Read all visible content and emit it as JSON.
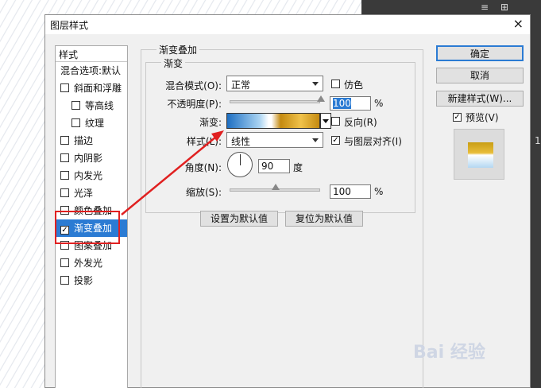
{
  "dialog": {
    "title": "图层样式",
    "close_icon": "×"
  },
  "left_panel": {
    "header": "样式",
    "items": [
      {
        "label": "混合选项:默认",
        "checkbox": false
      },
      {
        "label": "斜面和浮雕",
        "checkbox": true,
        "checked": false
      },
      {
        "label": "等高线",
        "checkbox": true,
        "checked": false
      },
      {
        "label": "纹理",
        "checkbox": true,
        "checked": false
      },
      {
        "label": "描边",
        "checkbox": true,
        "checked": false
      },
      {
        "label": "内阴影",
        "checkbox": true,
        "checked": false
      },
      {
        "label": "内发光",
        "checkbox": true,
        "checked": false
      },
      {
        "label": "光泽",
        "checkbox": true,
        "checked": false
      },
      {
        "label": "颜色叠加",
        "checkbox": true,
        "checked": false
      },
      {
        "label": "渐变叠加",
        "checkbox": true,
        "checked": true,
        "selected": true
      },
      {
        "label": "图案叠加",
        "checkbox": true,
        "checked": false
      },
      {
        "label": "外发光",
        "checkbox": true,
        "checked": false
      },
      {
        "label": "投影",
        "checkbox": true,
        "checked": false
      }
    ]
  },
  "gradient_overlay": {
    "group_title": "渐变叠加",
    "sub_group_title": "渐变",
    "blend_mode_label": "混合模式(O):",
    "blend_mode_value": "正常",
    "dither_label": "仿色",
    "opacity_label": "不透明度(P):",
    "opacity_value": "100",
    "opacity_unit": "%",
    "gradient_label": "渐变:",
    "reverse_label": "反向(R)",
    "style_label": "样式(L):",
    "style_value": "线性",
    "align_label": "与图层对齐(I)",
    "align_checked": true,
    "angle_label": "角度(N):",
    "angle_value": "90",
    "angle_unit": "度",
    "scale_label": "缩放(S):",
    "scale_value": "100",
    "scale_unit": "%",
    "opacity_level": 1.0,
    "scale_level": 0.5
  },
  "buttons": {
    "set_default": "设置为默认值",
    "reset_default": "复位为默认值",
    "ok": "确定",
    "cancel": "取消",
    "new_style": "新建样式(W)...",
    "preview_label": "预览(V)",
    "preview_checked": true
  },
  "background": {
    "toolbar_glyph_1": "≡",
    "toolbar_glyph_2": "⊞",
    "toolbar_glyph_3": "1"
  },
  "watermark": "Bai 经验"
}
